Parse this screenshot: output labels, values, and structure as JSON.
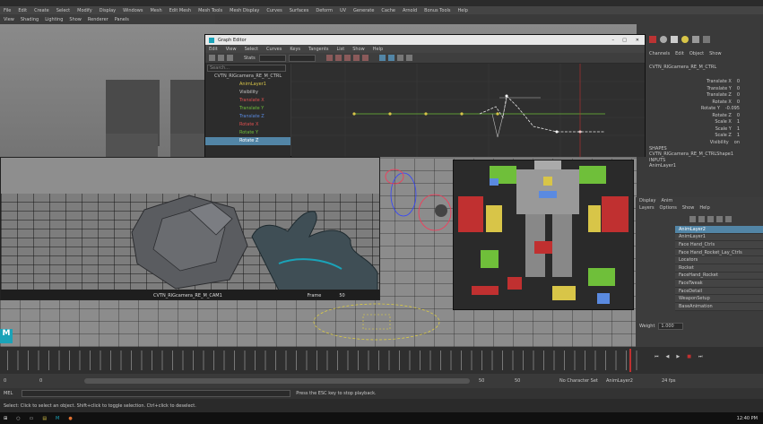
{
  "top_menu": [
    "File",
    "Edit",
    "Create",
    "Select",
    "Modify",
    "Display",
    "Windows",
    "Mesh",
    "Edit Mesh",
    "Mesh Tools",
    "Mesh Display",
    "Curves",
    "Surfaces",
    "Deform",
    "UV",
    "Generate",
    "Cache",
    "Arnold",
    "Bonus Tools",
    "Help"
  ],
  "viewport_menu": [
    "View",
    "Shading",
    "Lighting",
    "Show",
    "Renderer",
    "Panels"
  ],
  "graph_editor": {
    "title": "Graph Editor",
    "menu": [
      "Edit",
      "View",
      "Select",
      "Curves",
      "Keys",
      "Tangents",
      "List",
      "Show",
      "Help"
    ],
    "tools_label": "Stats",
    "outliner": {
      "search_placeholder": "Search...",
      "root": "CVTN_RIGcamera_RE_M_CTRL",
      "items": [
        "AnimLayer1",
        "Visibility",
        "Translate X",
        "Translate Y",
        "Translate Z",
        "Rotate X",
        "Rotate Y",
        "Rotate Z"
      ],
      "selected_index": 7
    }
  },
  "channel_box": {
    "menu": [
      "Channels",
      "Edit",
      "Object",
      "Show"
    ],
    "object_name": "CVTN_RIGcamera_RE_M_CTRL",
    "shape_label": "SHAPES",
    "shape_name": "CVTN_RIGcamera_RE_M_CTRLShape1",
    "inputs_label": "INPUTS",
    "input_name": "AnimLayer1",
    "channels": [
      {
        "name": "Translate X",
        "value": "0"
      },
      {
        "name": "Translate Y",
        "value": "0"
      },
      {
        "name": "Translate Z",
        "value": "0"
      },
      {
        "name": "Rotate X",
        "value": "0"
      },
      {
        "name": "Rotate Y",
        "value": "-0.095"
      },
      {
        "name": "Rotate Z",
        "value": "0"
      },
      {
        "name": "Scale X",
        "value": "1"
      },
      {
        "name": "Scale Y",
        "value": "1"
      },
      {
        "name": "Scale Z",
        "value": "1"
      },
      {
        "name": "Visibility",
        "value": "on"
      }
    ]
  },
  "camera_view": {
    "camera_name": "CVTN_RIGcamera_RE_M_CAM1",
    "frame_label": "Frame",
    "frame_value": "50"
  },
  "layer_editor": {
    "tabs": [
      "Display",
      "Anim"
    ],
    "menu": [
      "Layers",
      "Options",
      "Show",
      "Help"
    ],
    "layers": [
      {
        "name": "AnimLayer2",
        "selected": true
      },
      {
        "name": "AnimLayer1",
        "selected": false
      },
      {
        "name": "Face Hand_Ctrls",
        "selected": false
      },
      {
        "name": "Face Hand_Rocket_Lay_Ctrls",
        "selected": false
      },
      {
        "name": "Locators",
        "selected": false
      },
      {
        "name": "Rocket",
        "selected": false
      },
      {
        "name": "FaceHand_Rocket",
        "selected": false
      },
      {
        "name": "FaceTweak",
        "selected": false
      },
      {
        "name": "FaceDetail",
        "selected": false
      },
      {
        "name": "WeaponSetup",
        "selected": false
      },
      {
        "name": "BaseAnimation",
        "selected": false
      }
    ],
    "weight_label": "Weight",
    "weight_value": "1.000"
  },
  "timeline": {
    "start_frame": "0",
    "range_start": "0",
    "range_end": "50",
    "end_frame": "50",
    "current_frame": "50",
    "character_set": "No Character Set",
    "anim_layer": "AnimLayer2",
    "fps": "24 fps"
  },
  "command_line": {
    "label": "MEL",
    "help": "Press the ESC key to stop playback."
  },
  "help_line": "Select: Click to select an object. Shift+click to toggle selection. Ctrl+click to deselect.",
  "taskbar": {
    "time": "12:40 PM"
  },
  "colors": {
    "accent": "#5285a6",
    "curve_green": "#6fbf3a",
    "key_yellow": "#d8c548"
  }
}
